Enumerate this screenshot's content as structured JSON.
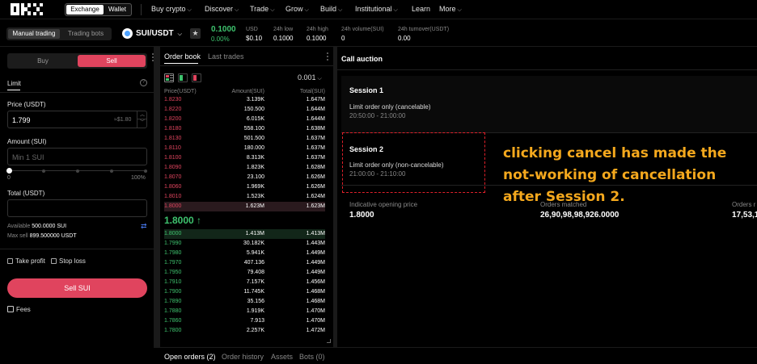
{
  "topnav": {
    "toggle": {
      "exchange": "Exchange",
      "wallet": "Wallet"
    },
    "items": [
      "Buy crypto",
      "Discover",
      "Trade",
      "Grow",
      "Build",
      "Institutional",
      "Learn",
      "More"
    ]
  },
  "ticker": {
    "modes": {
      "manual": "Manual trading",
      "bots": "Trading bots"
    },
    "pair": "SUI/USDT",
    "price": "0.1000",
    "change": "0.00%",
    "stats": [
      {
        "label": "USD",
        "value": "$0.10"
      },
      {
        "label": "24h low",
        "value": "0.1000"
      },
      {
        "label": "24h high",
        "value": "0.1000"
      },
      {
        "label": "24h volume(SUI)",
        "value": "0"
      },
      {
        "label": "24h turnover(USDT)",
        "value": "0.00"
      }
    ]
  },
  "trade_form": {
    "buy_label": "Buy",
    "sell_label": "Sell",
    "order_type": "Limit",
    "price_label": "Price (USDT)",
    "price_value": "1.799",
    "price_hint": "≈$1.80",
    "amount_label": "Amount (SUI)",
    "amount_placeholder": "Min 1 SUI",
    "slider_min": "0",
    "slider_max": "100%",
    "total_label": "Total (USDT)",
    "available_label": "Available",
    "available_value": "500.0000 SUI",
    "max_sell_label": "Max sell",
    "max_sell_value": "899.500000 USDT",
    "take_profit": "Take profit",
    "stop_loss": "Stop loss",
    "submit_label": "Sell SUI",
    "fees_label": "Fees"
  },
  "orderbook": {
    "tabs": [
      "Order book",
      "Last trades"
    ],
    "precision": "0.001",
    "headers": [
      "Price(USDT)",
      "Amount(SUI)",
      "Total(SUI)"
    ],
    "asks": [
      [
        "1.8230",
        "3.139K",
        "1.647M"
      ],
      [
        "1.8220",
        "150.500",
        "1.644M"
      ],
      [
        "1.8200",
        "6.015K",
        "1.644M"
      ],
      [
        "1.8180",
        "558.100",
        "1.638M"
      ],
      [
        "1.8130",
        "501.500",
        "1.637M"
      ],
      [
        "1.8110",
        "180.000",
        "1.637M"
      ],
      [
        "1.8100",
        "8.313K",
        "1.637M"
      ],
      [
        "1.8090",
        "1.823K",
        "1.628M"
      ],
      [
        "1.8070",
        "23.100",
        "1.626M"
      ],
      [
        "1.8060",
        "1.969K",
        "1.626M"
      ],
      [
        "1.8010",
        "1.523K",
        "1.624M"
      ],
      [
        "1.8000",
        "1.623M",
        "1.623M"
      ]
    ],
    "mid_price": "1.8000 ↑",
    "bids": [
      [
        "1.8000",
        "1.413M",
        "1.413M"
      ],
      [
        "1.7990",
        "30.182K",
        "1.443M"
      ],
      [
        "1.7980",
        "5.941K",
        "1.449M"
      ],
      [
        "1.7970",
        "407.136",
        "1.449M"
      ],
      [
        "1.7950",
        "79.408",
        "1.449M"
      ],
      [
        "1.7910",
        "7.157K",
        "1.456M"
      ],
      [
        "1.7900",
        "11.745K",
        "1.468M"
      ],
      [
        "1.7890",
        "35.156",
        "1.468M"
      ],
      [
        "1.7880",
        "1.919K",
        "1.470M"
      ],
      [
        "1.7860",
        "7.913",
        "1.470M"
      ],
      [
        "1.7800",
        "2.257K",
        "1.472M"
      ]
    ]
  },
  "auction": {
    "title": "Call auction",
    "session1": {
      "name": "Session 1",
      "rule": "Limit order only (cancelable)",
      "time": "20:50:00 - 21:00:00"
    },
    "session2": {
      "name": "Session 2",
      "rule": "Limit order only (non-cancelable)",
      "time": "21:00:00 - 21:10:00"
    },
    "annotation": "clicking cancel has made the not-working of cancellation after Session 2.",
    "metrics": [
      {
        "label": "Indicative opening price",
        "value": "1.8000"
      },
      {
        "label": "Orders matched",
        "value": "26,90,98,98,926.0000"
      },
      {
        "label": "Orders r",
        "value": "17,53,1"
      }
    ]
  },
  "bottom_tabs": [
    "Open orders (2)",
    "Order history",
    "Assets",
    "Bots (0)"
  ],
  "colors": {
    "sell": "#e0445e",
    "buy": "#3ec36e",
    "annotation": "#f4a81d"
  }
}
